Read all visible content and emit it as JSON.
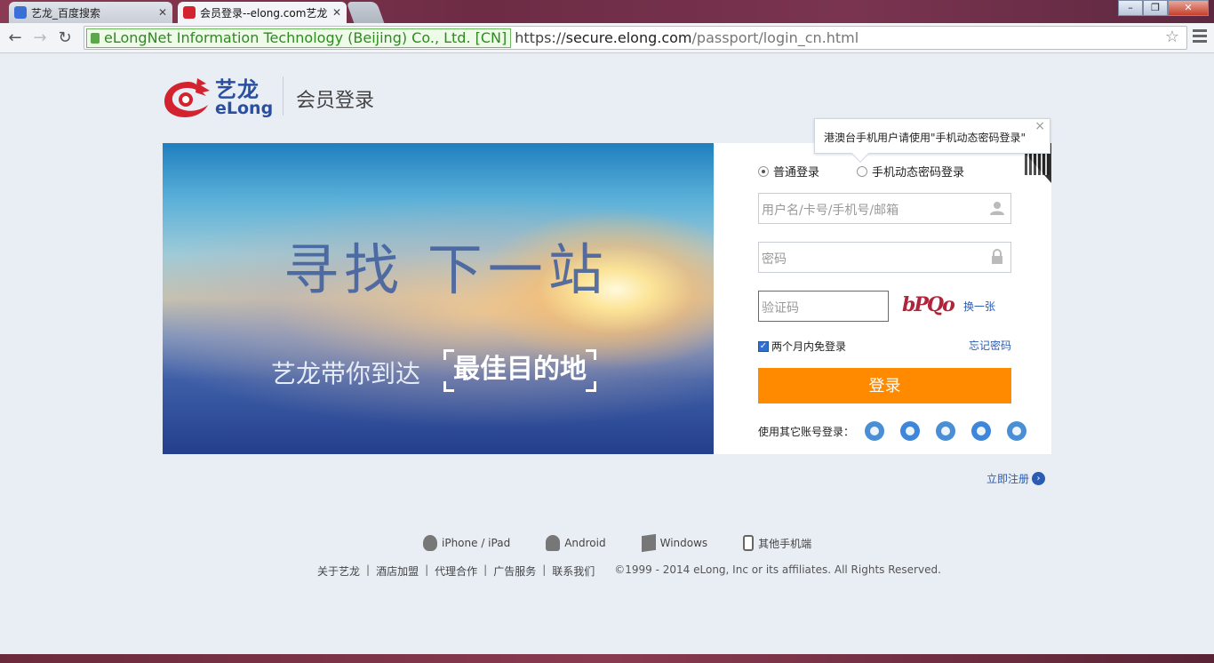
{
  "browser": {
    "tabs": [
      {
        "title": "艺龙_百度搜索",
        "active": false
      },
      {
        "title": "会员登录--elong.com艺龙",
        "active": true
      }
    ],
    "ev_cert": "eLongNet Information Technology (Beijing) Co., Ltd. [CN]",
    "url_scheme": "https://",
    "url_host": "secure.elong.com",
    "url_path": "/passport/login_cn.html"
  },
  "header": {
    "logo_cn": "艺龙",
    "logo_en": "eLong",
    "page_title": "会员登录"
  },
  "hero": {
    "headline": "寻找  下一站",
    "subline": "艺龙带你到达",
    "highlight": "最佳目的地"
  },
  "login": {
    "tooltip": "港澳台手机用户请使用\"手机动态密码登录\"",
    "mode_normal": "普通登录",
    "mode_dynamic": "手机动态密码登录",
    "username_placeholder": "用户名/卡号/手机号/邮箱",
    "password_placeholder": "密码",
    "captcha_placeholder": "验证码",
    "captcha_text": "bPQo",
    "refresh_label": "换一张",
    "remember_label": "两个月内免登录",
    "forgot_label": "忘记密码",
    "submit_label": "登录",
    "other_accounts_label": "使用其它账号登录：",
    "social": [
      "wechat-icon",
      "qq-icon",
      "weibo-icon",
      "alipay-icon",
      "renren-icon"
    ]
  },
  "register_label": "立即注册",
  "apps": [
    "iPhone / iPad",
    "Android",
    "Windows",
    "其他手机端"
  ],
  "footer": {
    "links": [
      "关于艺龙",
      "酒店加盟",
      "代理合作",
      "广告服务",
      "联系我们"
    ],
    "copyright": "©1999 - 2014 eLong, Inc or its affiliates. All Rights Reserved."
  },
  "colors": {
    "accent_orange": "#ff8a00",
    "link_blue": "#2a5cb3",
    "brand_red": "#d3232e",
    "brand_blue": "#2a4fa0"
  }
}
